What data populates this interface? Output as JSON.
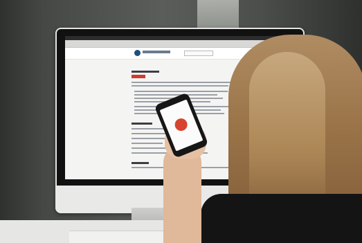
{
  "scene": {
    "description_type": "photo",
    "colors": {
      "wall": "#4b4e4b",
      "monitor_frame": "#e5e6e4",
      "screen_background": "#f4f4f2",
      "accent_red": "#d23a2e",
      "logo_blue": "#1f4e7a",
      "hair": "#9a7348",
      "shirt": "#141414",
      "skin": "#e0b89a"
    },
    "phone_app_icon": "app-logo-icon"
  }
}
